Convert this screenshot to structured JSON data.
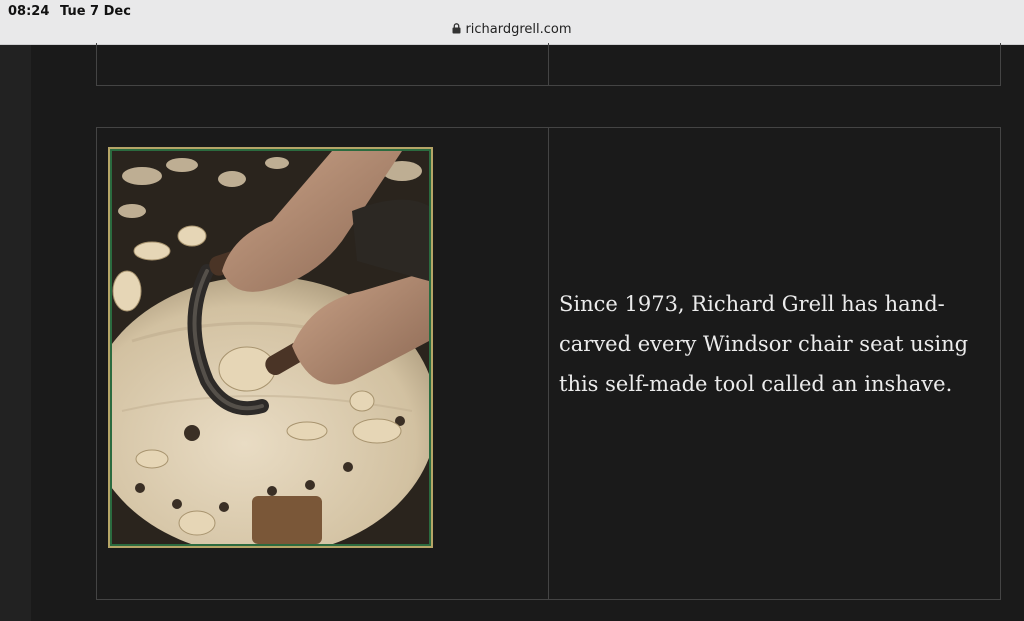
{
  "status_bar": {
    "time": "08:24",
    "date": "Tue 7 Dec",
    "url": "richardgrell.com",
    "lock_icon": "lock-icon"
  },
  "content": {
    "caption": "Since 1973, Richard Grell has hand-carved every Windsor chair seat using this self-made tool called an inshave.",
    "photo_subject": "photo-inshave-carving-chair-seat"
  },
  "colors": {
    "background": "#1a1a1a",
    "frame": "#b5a567",
    "border": "#444444",
    "text": "#ebebeb"
  }
}
